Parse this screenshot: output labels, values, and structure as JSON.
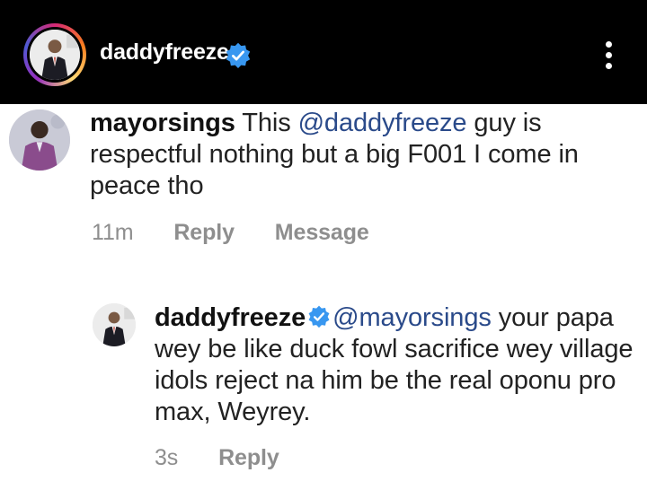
{
  "header": {
    "username": "daddyfreeze",
    "verified_icon": "verified-badge-icon",
    "more_icon": "more-vertical-icon"
  },
  "comments": [
    {
      "username": "mayorsings",
      "text_before": "This ",
      "mention": "@daddyfreeze",
      "text_after": " guy is respectful nothing but a big F001 I come in peace tho",
      "time": "11m",
      "reply_label": "Reply",
      "message_label": "Message"
    },
    {
      "username": "daddyfreeze",
      "verified": true,
      "mention": "@mayorsings",
      "text_after": " your papa wey be like duck fowl sacrifice wey village idols reject na him be the real oponu pro max, Weyrey.",
      "time": "3s",
      "reply_label": "Reply"
    }
  ],
  "colors": {
    "header_bg": "#000000",
    "verified_blue": "#3897f0",
    "mention_blue": "#2a4a8a",
    "meta_gray": "#8e8e8e"
  }
}
